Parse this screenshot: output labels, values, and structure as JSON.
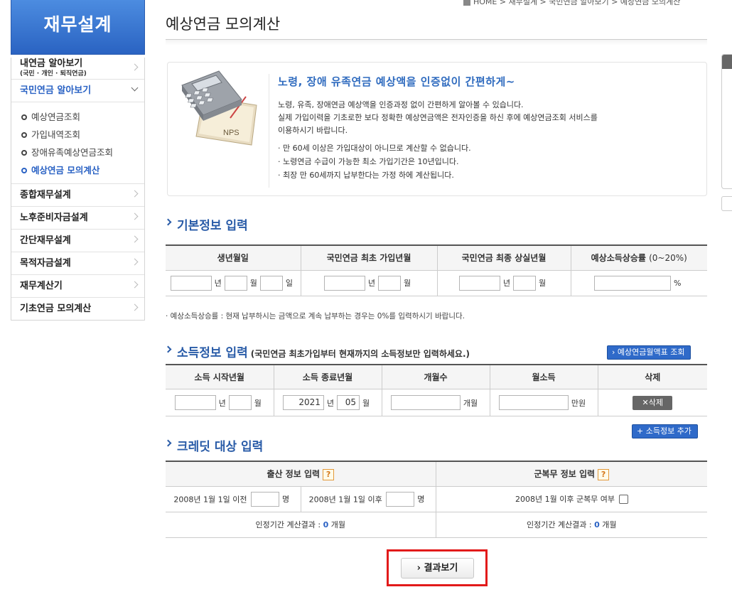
{
  "breadcrumb": "HOME > 재무설계 > 국민연금 알아보기 > 예상연금 모의계산",
  "sidebar": {
    "heading": "재무설계",
    "items": [
      {
        "label": "내연금 알아보기",
        "sub": "(국민 · 개인 · 퇴직연금)"
      },
      {
        "label": "국민연금 알아보기"
      },
      {
        "label": "종합재무설계"
      },
      {
        "label": "노후준비자금설계"
      },
      {
        "label": "간단재무설계"
      },
      {
        "label": "목적자금설계"
      },
      {
        "label": "재무계산기"
      },
      {
        "label": "기초연금 모의계산"
      }
    ],
    "subitems": [
      "예상연금조회",
      "가입내역조회",
      "장애유족예상연금조회",
      "예상연금 모의계산"
    ]
  },
  "page": {
    "title": "예상연금 모의계산"
  },
  "intro": {
    "illustration_label": "NPS",
    "headline": "노령, 장애 유족연금 예상액을 인증없이 간편하게~",
    "para1": "노령, 유족, 장애연금 예상액을 인증과정 없이 간편하게 알아볼 수 있습니다.",
    "para2": "실제 가입이력을 기초로한 보다 정확한 예상연금액은 전자인증을 하신 후에 예상연금조회 서비스를",
    "para3": "이용하시기 바랍니다.",
    "notes": [
      "· 만 60세 이상은 가입대상이 아니므로 계산할 수 없습니다.",
      "· 노령연금 수급이 가능한 최소 가입기간은 10년입니다.",
      "· 최장 만 60세까지 납부한다는 가정 하에 계산됩니다."
    ]
  },
  "basic": {
    "title": "기본정보 입력",
    "headers": [
      "생년월일",
      "국민연금 최초 가입년월",
      "국민연금 최종 상실년월",
      "예상소득상승률"
    ],
    "rate_hint": "(0~20%)",
    "units": {
      "year": "년",
      "month": "월",
      "day": "일",
      "percent": "%"
    },
    "note": "· 예상소득상승률 : 현재 납부하시는 금액으로 계속 납부하는 경우는 0%를 입력하시기 바랍니다."
  },
  "income": {
    "title": "소득정보 입력",
    "subtitle": "(국민연금 최초가입부터 현재까지의 소득정보만 입력하세요.)",
    "lookup_button": "› 예상연금월액표 조회",
    "headers": [
      "소득 시작년월",
      "소득 종료년월",
      "개월수",
      "월소득",
      "삭제"
    ],
    "end_year": "2021",
    "end_month": "05",
    "units": {
      "year": "년",
      "month": "월",
      "months": "개월",
      "won": "만원"
    },
    "delete_button": "✕삭제",
    "add_button": "+ 소득정보 추가"
  },
  "credit": {
    "title": "크레딧 대상 입력",
    "birth_header": "출산 정보 입력",
    "military_header": "군복무 정보 입력",
    "help": "?",
    "before_label": "2008년 1월 1일 이전",
    "after_label": "2008년 1월 1일 이후",
    "person_unit": "명",
    "military_label": "2008년 1월 이후 군복무 여부",
    "result_prefix": "인정기간 계산결과 :",
    "birth_result": "0",
    "military_result": "0",
    "result_unit": "개월"
  },
  "result_button": "› 결과보기"
}
